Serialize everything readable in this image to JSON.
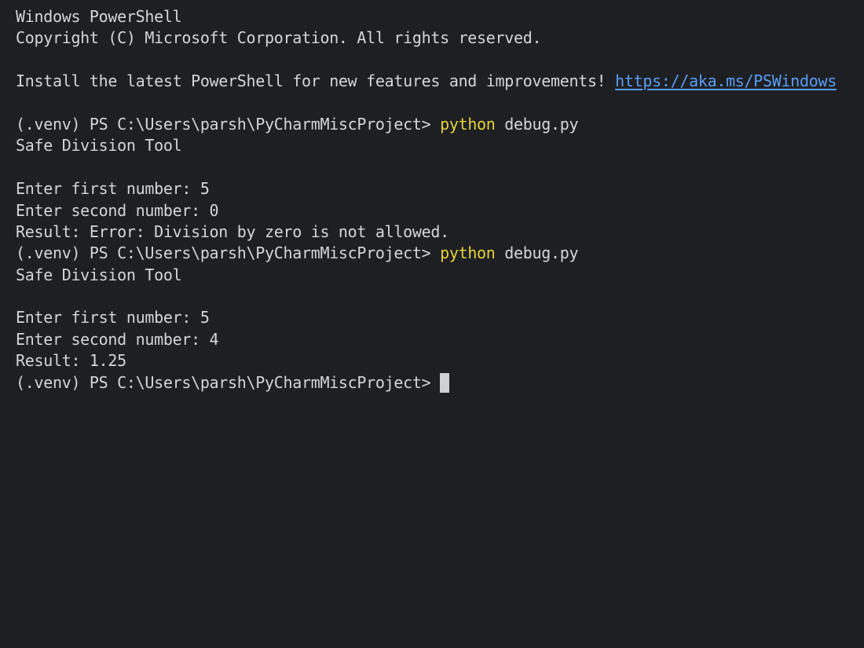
{
  "terminal": {
    "header": {
      "title": "Windows PowerShell",
      "copyright": "Copyright (C) Microsoft Corporation. All rights reserved.",
      "install_message": "Install the latest PowerShell for new features and improvements! ",
      "install_link": "https://aka.ms/PSWindows"
    },
    "prompt": "(.venv) PS C:\\Users\\parsh\\PyCharmMiscProject> ",
    "runs": [
      {
        "command": "python",
        "args": " debug.py",
        "tool_title": "Safe Division Tool",
        "first_input": "Enter first number: 5",
        "second_input": "Enter second number: 0",
        "result": "Result: Error: Division by zero is not allowed."
      },
      {
        "command": "python",
        "args": " debug.py",
        "tool_title": "Safe Division Tool",
        "first_input": "Enter first number: 5",
        "second_input": "Enter second number: 4",
        "result": "Result: 1.25"
      }
    ]
  },
  "colors": {
    "background": "#1e1f22",
    "text": "#d3d6db",
    "command": "#e5d33a",
    "link": "#589df6",
    "cursor": "#cfd1d5"
  }
}
